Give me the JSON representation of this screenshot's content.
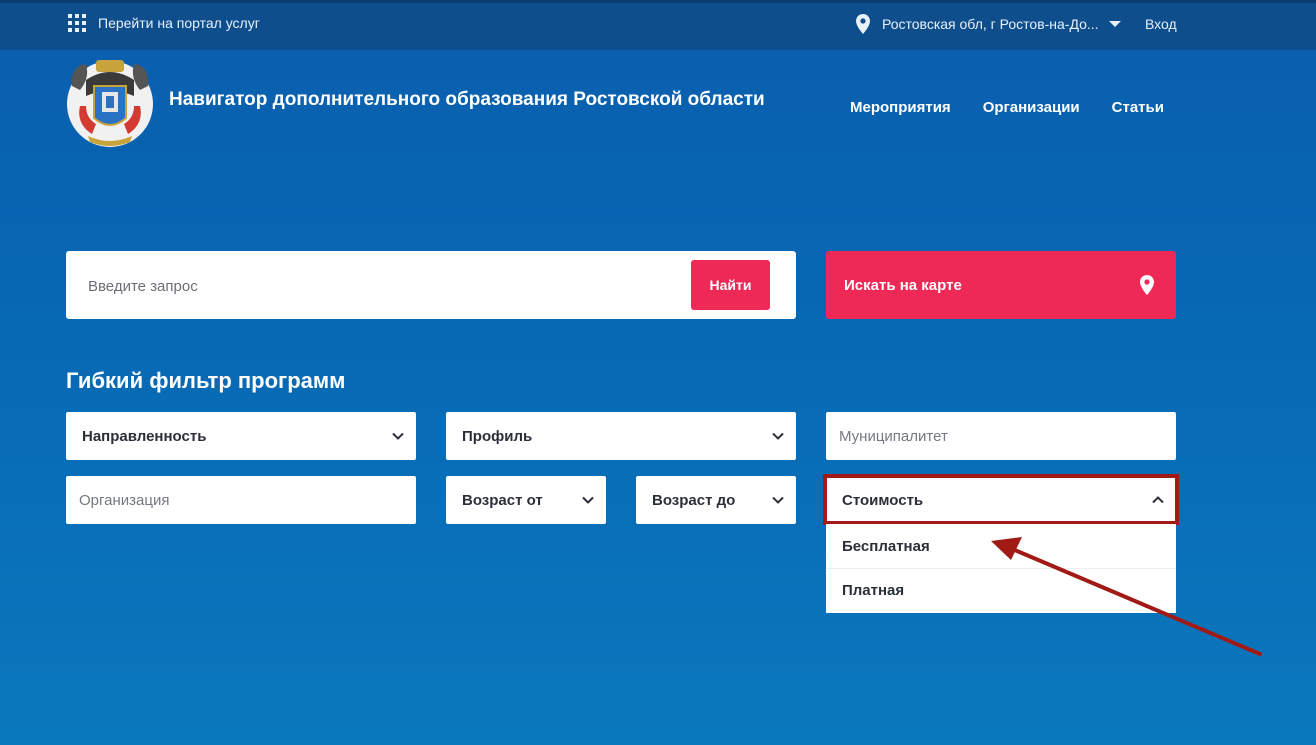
{
  "topbar": {
    "portal_link": "Перейти на портал услуг",
    "region": "Ростовская обл, г Ростов-на-До...",
    "login": "Вход"
  },
  "header": {
    "title": "Навигатор дополнительного образования Ростовской области",
    "nav": [
      "Мероприятия",
      "Организации",
      "Статьи"
    ]
  },
  "search": {
    "placeholder": "Введите запрос",
    "button": "Найти",
    "map_button": "Искать на карте"
  },
  "filter": {
    "title": "Гибкий фильтр программ",
    "direction": "Направленность",
    "profile": "Профиль",
    "municipality_placeholder": "Муниципалитет",
    "organization_placeholder": "Организация",
    "age_from": "Возраст от",
    "age_to": "Возраст до",
    "cost": "Стоимость",
    "cost_options": [
      "Бесплатная",
      "Платная"
    ]
  },
  "colors": {
    "background": "#0767b3",
    "topbar": "#0e4e8c",
    "accent": "#ee2955",
    "annotation": "#a11a15"
  }
}
